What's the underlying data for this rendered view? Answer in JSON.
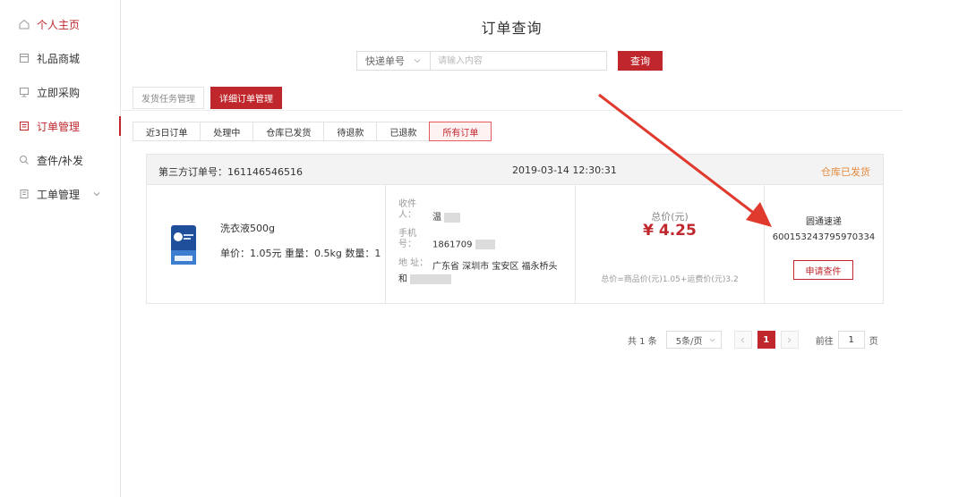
{
  "sidebar": {
    "items": [
      {
        "label": "个人主页",
        "icon": "home-icon",
        "active": true
      },
      {
        "label": "礼品商城",
        "icon": "mall-icon",
        "active": false
      },
      {
        "label": "立即采购",
        "icon": "purchase-icon",
        "active": false
      },
      {
        "label": "订单管理",
        "icon": "order-icon",
        "active": true
      },
      {
        "label": "查件/补发",
        "icon": "search-icon",
        "active": false
      },
      {
        "label": "工单管理",
        "icon": "ticket-icon",
        "active": false,
        "expandable": true
      }
    ]
  },
  "page": {
    "title": "订单查询"
  },
  "search": {
    "type_label": "快递单号",
    "placeholder": "请输入内容",
    "button": "查询"
  },
  "main_tabs": [
    {
      "label": "发货任务管理",
      "active": false
    },
    {
      "label": "详细订单管理",
      "active": true
    }
  ],
  "sub_tabs": [
    {
      "label": "近3日订单",
      "active": false
    },
    {
      "label": "处理中",
      "active": false
    },
    {
      "label": "仓库已发货",
      "active": false
    },
    {
      "label": "待退款",
      "active": false
    },
    {
      "label": "已退款",
      "active": false
    },
    {
      "label": "所有订单",
      "active": true
    }
  ],
  "order": {
    "number_text": "第三方订单号：161146546516",
    "time": "2019-03-14 12:30:31",
    "status": "仓库已发货",
    "product": {
      "name": "洗衣液500g",
      "meta": "单价：1.05元   重量：0.5kg   数量：1"
    },
    "address": {
      "receiver_label": "收件人：",
      "receiver_value": "温",
      "phone_label": "手机号：",
      "phone_value": "1861709",
      "address_label": "地 址：",
      "address_value_line1": "广东省 深圳市 宝安区 福永桥头",
      "address_value_line2": "和"
    },
    "price": {
      "label": "总价(元)",
      "value": "¥ 4.25",
      "formula": "总价=商品价(元)1.05+运费价(元)3.2"
    },
    "shipping": {
      "carrier": "圆通速递",
      "tracking": "600153243795970334",
      "button": "申请查件"
    }
  },
  "pager": {
    "total": "共 1 条",
    "size": "5条/页",
    "current": "1",
    "goto_label": "前往",
    "goto_value": "1",
    "unit": "页"
  },
  "colors": {
    "accent": "#c0272d",
    "status": "#e58a3d"
  }
}
